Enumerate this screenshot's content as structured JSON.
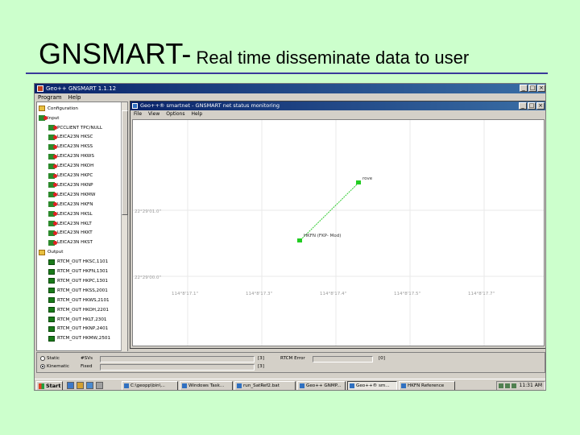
{
  "slide": {
    "title_main": "GNSMART-",
    "title_sub": " Real time disseminate data to user"
  },
  "outer_window": {
    "title": "Geo++ GNSMART 1.1.12",
    "menu": [
      "Program",
      "Help"
    ],
    "controls": [
      "_",
      "□",
      "×"
    ]
  },
  "tree": {
    "items": [
      {
        "label": "Configuration",
        "level": 0,
        "icon": "folder-icon"
      },
      {
        "label": "Input",
        "level": 0,
        "icon": "input-icon"
      },
      {
        "label": "PCCLIENT TPC/NULL",
        "level": 1,
        "icon": "input-status-icon"
      },
      {
        "label": "LEICA23N HKSC",
        "level": 1,
        "icon": "input-status-icon"
      },
      {
        "label": "LEICA23N HKSS",
        "level": 1,
        "icon": "input-status-icon"
      },
      {
        "label": "LEICA23N HKWS",
        "level": 1,
        "icon": "input-status-icon"
      },
      {
        "label": "LEICA23N HKOH",
        "level": 1,
        "icon": "input-status-icon"
      },
      {
        "label": "LEICA23N HKPC",
        "level": 1,
        "icon": "input-status-icon"
      },
      {
        "label": "LEICA23N HKNP",
        "level": 1,
        "icon": "input-status-icon"
      },
      {
        "label": "LEICA23N HKMW",
        "level": 1,
        "icon": "input-status-icon"
      },
      {
        "label": "LEICA23N HKFN",
        "level": 1,
        "icon": "input-status-icon"
      },
      {
        "label": "LEICA23N HKSL",
        "level": 1,
        "icon": "input-status-icon"
      },
      {
        "label": "LEICA23N HKLT",
        "level": 1,
        "icon": "input-status-icon"
      },
      {
        "label": "LEICA23N HKKT",
        "level": 1,
        "icon": "input-status-icon"
      },
      {
        "label": "LEICA23N HKST",
        "level": 1,
        "icon": "input-status-icon"
      },
      {
        "label": "Output",
        "level": 0,
        "icon": "output-icon"
      },
      {
        "label": "RTCM_OUT HKSC,1101",
        "level": 1,
        "icon": "output-status-icon"
      },
      {
        "label": "RTCM_OUT HKFN,1301",
        "level": 1,
        "icon": "output-status-icon"
      },
      {
        "label": "RTCM_OUT HKPC,1301",
        "level": 1,
        "icon": "output-status-icon"
      },
      {
        "label": "RTCM_OUT HKSS,2001",
        "level": 1,
        "icon": "output-status-icon"
      },
      {
        "label": "RTCM_OUT HKWS,2101",
        "level": 1,
        "icon": "output-status-icon"
      },
      {
        "label": "RTCM_OUT HKOH,2201",
        "level": 1,
        "icon": "output-status-icon"
      },
      {
        "label": "RTCM_OUT HKLT,2301",
        "level": 1,
        "icon": "output-status-icon"
      },
      {
        "label": "RTCM_OUT HKNP,2401",
        "level": 1,
        "icon": "output-status-icon"
      },
      {
        "label": "RTCM_OUT HKMW,2501",
        "level": 1,
        "icon": "output-status-icon"
      }
    ]
  },
  "inner_window": {
    "title": "Geo++® smartnet - GNSMART net status monitoring",
    "menu": [
      "File",
      "View",
      "Options",
      "Help"
    ],
    "controls": [
      "_",
      "□",
      "×"
    ]
  },
  "map": {
    "y_ticks": [
      "22°29'01.0\"",
      "22°29'00.0\""
    ],
    "x_ticks": [
      "114°8'17.1\"",
      "114°8'17.3\"",
      "114°8'17.4\"",
      "114°8'17.5\"",
      "114°8'17.7\""
    ],
    "points": [
      {
        "label": "rove",
        "lon": 114.138156,
        "lat": 22.48372
      },
      {
        "label": "HKFN (FKP- Mod)",
        "lon": 114.138145,
        "lat": 22.4834
      }
    ]
  },
  "status": {
    "static_label": "Static",
    "kinematic_label": "Kinematic",
    "svs_label": "#SVs",
    "fixed_label": "Fixed",
    "svs_count": "[3]",
    "fixed_count": "[3]",
    "rtcm_error_label": "RTCM Error",
    "rtcm_error_count": "[0]"
  },
  "taskbar": {
    "start_label": "Start",
    "tasks": [
      {
        "label": "C:\\geopp\\bin\\...",
        "active": false
      },
      {
        "label": "Windows Task...",
        "active": false
      },
      {
        "label": "run_SatRef2.bat",
        "active": false
      },
      {
        "label": "Geo++ GNMP...",
        "active": false
      },
      {
        "label": "Geo++® sm...",
        "active": true
      },
      {
        "label": "HKFN Reference",
        "active": false
      }
    ],
    "clock": "11:31 AM"
  }
}
